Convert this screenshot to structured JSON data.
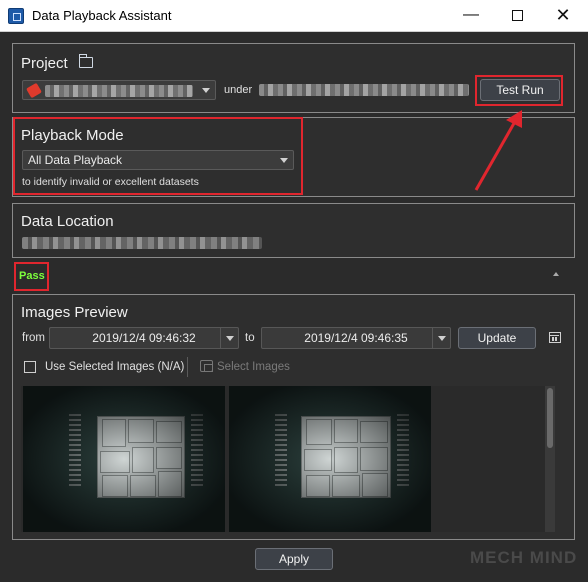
{
  "window": {
    "title": "Data Playback Assistant",
    "minimize": "—",
    "close": "✕"
  },
  "project": {
    "title": "Project",
    "under_label": "under",
    "test_run_label": "Test Run"
  },
  "playback_mode": {
    "title": "Playback Mode",
    "selected": "All Data Playback",
    "hint": "to identify invalid or excellent datasets"
  },
  "data_location": {
    "title": "Data Location"
  },
  "status": {
    "text": "Pass",
    "color": "#7dff3c"
  },
  "images_preview": {
    "title": "Images Preview",
    "from_label": "from",
    "from_value": "2019/12/4 09:46:32",
    "to_label": "to",
    "to_value": "2019/12/4 09:46:35",
    "update_label": "Update",
    "use_selected_label": "Use Selected Images (N/A)",
    "select_images_label": "Select Images"
  },
  "footer": {
    "apply_label": "Apply",
    "watermark": "MECH MIND"
  },
  "colors": {
    "highlight": "#e0262e",
    "background": "#2b2b2b",
    "panel_border": "#8a8a8a"
  },
  "icons": [
    "app-icon",
    "folder-icon",
    "calendar-icon",
    "select-images-icon",
    "collapse-icon"
  ]
}
